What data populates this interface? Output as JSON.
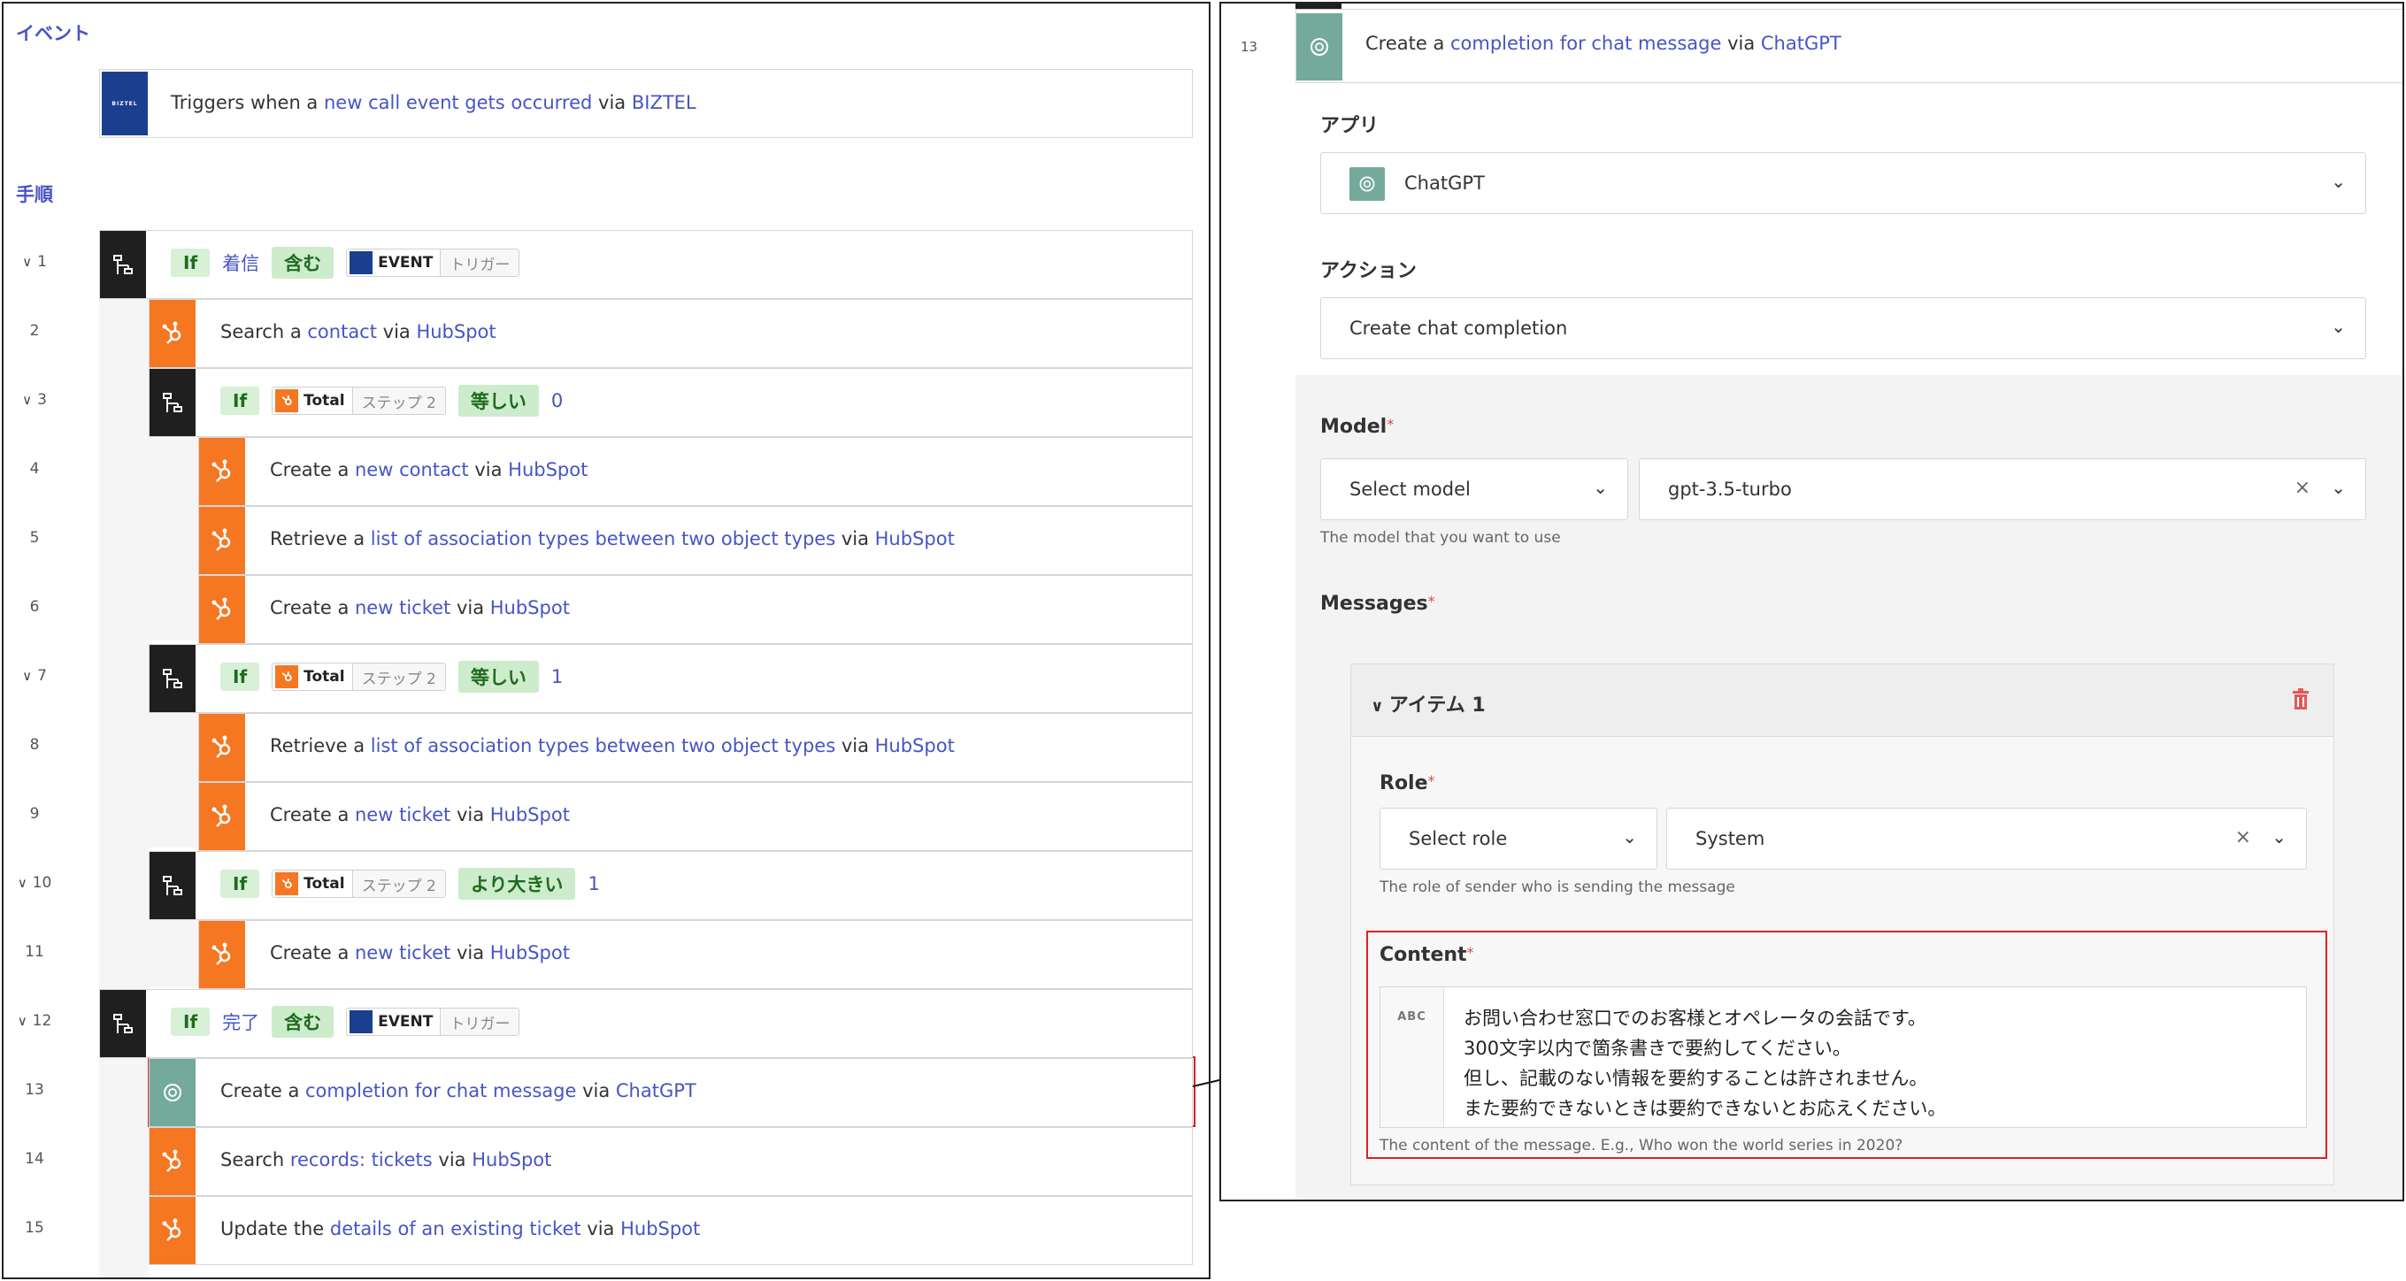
{
  "left": {
    "event_label": "イベント",
    "steps_label": "手順",
    "event_row": {
      "logo": "BIZTEL",
      "prefix": "Triggers when a ",
      "link": "new call event gets occurred",
      "mid": " via ",
      "app": "BIZTEL"
    },
    "steps": [
      {
        "num": "1",
        "chev": "∨",
        "field": "着信",
        "op": "含む",
        "chip_name": "EVENT",
        "chip_sub": "トリガー",
        "if": "If"
      },
      {
        "num": "2",
        "prefix": "Search a ",
        "link": "contact",
        "mid": " via ",
        "app": "HubSpot"
      },
      {
        "num": "3",
        "chev": "∨",
        "if": "If",
        "chip_name": "Total",
        "chip_sub": "ステップ 2",
        "op": "等しい",
        "val": "0"
      },
      {
        "num": "4",
        "prefix": "Create a ",
        "link": "new contact",
        "mid": " via ",
        "app": "HubSpot"
      },
      {
        "num": "5",
        "prefix": "Retrieve a ",
        "link": "list of association types between two object types",
        "mid": " via ",
        "app": "HubSpot"
      },
      {
        "num": "6",
        "prefix": "Create a ",
        "link": "new ticket",
        "mid": " via ",
        "app": "HubSpot"
      },
      {
        "num": "7",
        "chev": "∨",
        "if": "If",
        "chip_name": "Total",
        "chip_sub": "ステップ 2",
        "op": "等しい",
        "val": "1"
      },
      {
        "num": "8",
        "prefix": "Retrieve a ",
        "link": "list of association types between two object types",
        "mid": " via ",
        "app": "HubSpot"
      },
      {
        "num": "9",
        "prefix": "Create a ",
        "link": "new ticket",
        "mid": " via ",
        "app": "HubSpot"
      },
      {
        "num": "10",
        "chev": "∨",
        "if": "If",
        "chip_name": "Total",
        "chip_sub": "ステップ 2",
        "op": "より大きい",
        "val": "1"
      },
      {
        "num": "11",
        "prefix": "Create a ",
        "link": "new ticket",
        "mid": " via ",
        "app": "HubSpot"
      },
      {
        "num": "12",
        "chev": "∨",
        "if": "If",
        "field": "完了",
        "op": "含む",
        "chip_name": "EVENT",
        "chip_sub": "トリガー"
      },
      {
        "num": "13",
        "prefix": "Create a ",
        "link": "completion for chat message",
        "mid": " via ",
        "app": "ChatGPT"
      },
      {
        "num": "14",
        "prefix": "Search ",
        "link": "records: tickets",
        "mid": " via ",
        "app": "HubSpot"
      },
      {
        "num": "15",
        "prefix": "Update the ",
        "link": "details of an existing ticket",
        "mid": " via ",
        "app": "HubSpot"
      }
    ]
  },
  "right": {
    "step_num": "13",
    "header": {
      "prefix": "Create a ",
      "link": "completion for chat message",
      "mid": " via ",
      "app": "ChatGPT"
    },
    "app_label": "アプリ",
    "app_value": "ChatGPT",
    "action_label": "アクション",
    "action_value": "Create chat completion",
    "model_label": "Model",
    "model_select": "Select model",
    "model_value": "gpt-3.5-turbo",
    "model_help": "The model that you want to use",
    "messages_label": "Messages",
    "item_title": "アイテム 1",
    "role_label": "Role",
    "role_select": "Select role",
    "role_value": "System",
    "role_help": "The role of sender who is sending the message",
    "content_label": "Content",
    "content_type": "ABC",
    "content_lines": [
      "お問い合わせ窓口でのお客様とオペレータの会話です。",
      "300文字以内で箇条書きで要約してください。",
      "但し、記載のない情報を要約することは許されません。",
      "また要約できないときは要約できないとお応えください。"
    ],
    "content_help": "The content of the message. E.g., Who won the world series in 2020?",
    "required_mark": "*"
  },
  "colors": {
    "hubspot": "#f57722",
    "chatgpt": "#74aa9c",
    "link": "#4655c4",
    "highlight": "#e02020",
    "branch": "#1f1f1f",
    "biztel": "#1b3f8f"
  }
}
